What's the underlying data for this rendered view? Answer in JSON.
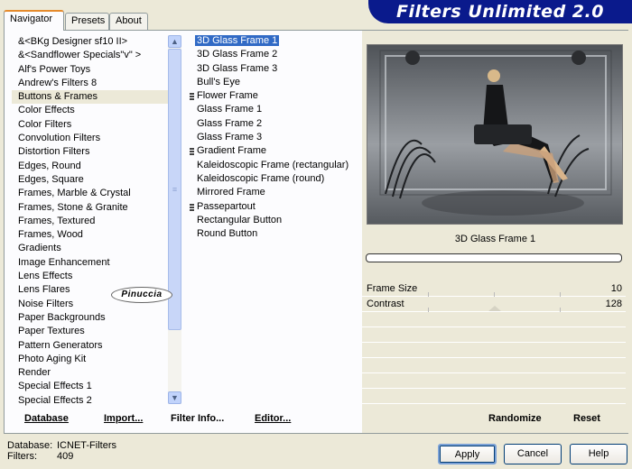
{
  "tabs": [
    "Navigator",
    "Presets",
    "About"
  ],
  "app_title": "Filters Unlimited 2.0",
  "categories": [
    "&<BKg Designer sf10 II>",
    "&<Sandflower Specials\"v\" >",
    "Alf's Power Toys",
    "Andrew's Filters 8",
    "Buttons & Frames",
    "Color Effects",
    "Color Filters",
    "Convolution Filters",
    "Distortion Filters",
    "Edges, Round",
    "Edges, Square",
    "Frames, Marble & Crystal",
    "Frames, Stone & Granite",
    "Frames, Textured",
    "Frames, Wood",
    "Gradients",
    "Image Enhancement",
    "Lens Effects",
    "Lens Flares",
    "Noise Filters",
    "Paper Backgrounds",
    "Paper Textures",
    "Pattern Generators",
    "Photo Aging Kit",
    "Render",
    "Special Effects 1",
    "Special Effects 2"
  ],
  "selected_category": "Buttons & Frames",
  "filters": [
    {
      "label": "3D Glass Frame 1",
      "group": false
    },
    {
      "label": "3D Glass Frame 2",
      "group": false
    },
    {
      "label": "3D Glass Frame 3",
      "group": false
    },
    {
      "label": "Bull's Eye",
      "group": false
    },
    {
      "label": "Flower Frame",
      "group": true
    },
    {
      "label": "Glass Frame 1",
      "group": false
    },
    {
      "label": "Glass Frame 2",
      "group": false
    },
    {
      "label": "Glass Frame 3",
      "group": false
    },
    {
      "label": "Gradient Frame",
      "group": true
    },
    {
      "label": "Kaleidoscopic Frame (rectangular)",
      "group": false
    },
    {
      "label": "Kaleidoscopic Frame (round)",
      "group": false
    },
    {
      "label": "Mirrored Frame",
      "group": false
    },
    {
      "label": "Passepartout",
      "group": true
    },
    {
      "label": "Rectangular Button",
      "group": false
    },
    {
      "label": "Round Button",
      "group": false
    }
  ],
  "selected_filter": "3D Glass Frame 1",
  "preview": {
    "caption": "3D Glass Frame 1",
    "watermark": "Pinuccia"
  },
  "parameters": [
    {
      "name": "Frame Size",
      "value": "10"
    },
    {
      "name": "Contrast",
      "value": "128"
    }
  ],
  "commands": {
    "database": "Database",
    "import": "Import...",
    "filter_info": "Filter Info...",
    "editor": "Editor...",
    "randomize": "Randomize",
    "reset": "Reset"
  },
  "status": {
    "database_label": "Database:",
    "database_value": "ICNET-Filters",
    "filters_label": "Filters:",
    "filters_value": "409"
  },
  "buttons": {
    "apply": "Apply",
    "cancel": "Cancel",
    "help": "Help"
  }
}
